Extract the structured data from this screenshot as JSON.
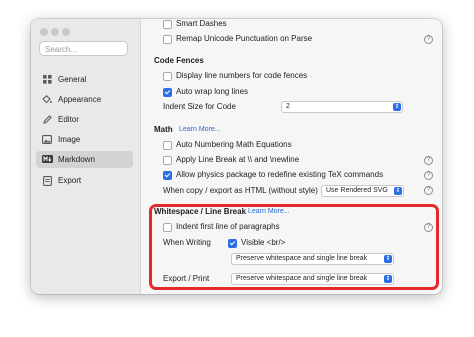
{
  "sidebar": {
    "search_placeholder": "Search...",
    "items": [
      {
        "label": "General",
        "icon": "grid-icon"
      },
      {
        "label": "Appearance",
        "icon": "paint-bucket-icon"
      },
      {
        "label": "Editor",
        "icon": "pencil-icon"
      },
      {
        "label": "Image",
        "icon": "image-icon"
      },
      {
        "label": "Markdown",
        "icon": "markdown-icon",
        "active": true
      },
      {
        "label": "Export",
        "icon": "export-icon"
      }
    ]
  },
  "top": {
    "smart_dashes": "Smart Dashes",
    "remap_unicode": "Remap Unicode Punctuation on Parse"
  },
  "code_fences": {
    "heading": "Code Fences",
    "line_numbers": "Display line numbers for code fences",
    "auto_wrap": "Auto wrap long lines",
    "indent_label": "Indent Size for Code",
    "indent_value": "2"
  },
  "math": {
    "heading": "Math",
    "learn_more": "Learn More...",
    "auto_numbering": "Auto Numbering Math Equations",
    "line_break": "Apply Line Break at \\\\ and \\newline",
    "physics": "Allow physics package to redefine existing TeX commands",
    "copy_label": "When copy / export as HTML (without style)",
    "copy_value": "Use Rendered SVG"
  },
  "whitespace": {
    "heading": "Whitespace / Line Break",
    "learn_more": "Learn More...",
    "indent_first": "Indent first line of paragraphs",
    "when_writing": "When Writing",
    "visible_br": "Visible <br/>",
    "writing_select": "Preserve whitespace and single line break",
    "export_label": "Export / Print",
    "export_select": "Preserve whitespace and single line break"
  },
  "colors": {
    "accent": "#2c6ee6",
    "highlight": "#e32929"
  }
}
